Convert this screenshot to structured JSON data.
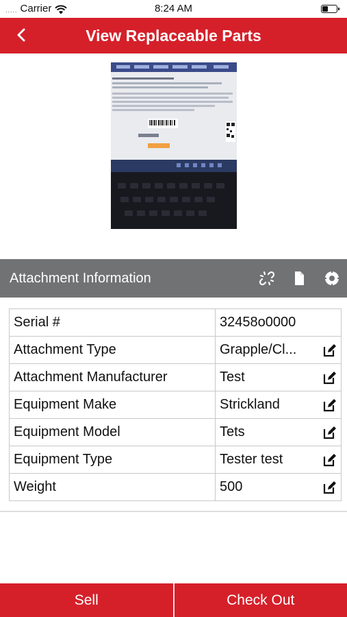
{
  "status_bar": {
    "signal": ".....",
    "carrier": "Carrier",
    "time": "8:24 AM",
    "battery_level": 0.35
  },
  "nav": {
    "title": "View Replaceable Parts",
    "back_icon": "chevron-left-icon"
  },
  "section": {
    "title": "Attachment Information",
    "icons": [
      "broken-link-icon",
      "document-icon",
      "target-icon"
    ]
  },
  "fields": [
    {
      "label": "Serial #",
      "value": "32458o0000",
      "editable": false
    },
    {
      "label": "Attachment Type",
      "value": "Grapple/Cl...",
      "editable": true
    },
    {
      "label": "Attachment Manufacturer",
      "value": "Test",
      "editable": true
    },
    {
      "label": "Equipment Make",
      "value": "Strickland",
      "editable": true
    },
    {
      "label": "Equipment Model",
      "value": "Tets",
      "editable": true
    },
    {
      "label": "Equipment Type",
      "value": "Tester test",
      "editable": true
    },
    {
      "label": "Weight",
      "value": "500",
      "editable": true
    }
  ],
  "actions": {
    "sell": "Sell",
    "check_out": "Check Out"
  },
  "colors": {
    "brand_red": "#d5202a",
    "section_gray": "#717273"
  }
}
